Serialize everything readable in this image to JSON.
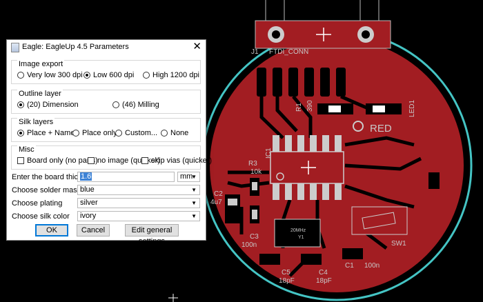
{
  "dialog": {
    "title": "Eagle: EagleUp 4.5 Parameters",
    "close_glyph": "✕",
    "image_export": {
      "legend": "Image export",
      "options": [
        "Very low 300 dpi",
        "Low 600 dpi",
        "High 1200 dpi"
      ],
      "selected": "Low 600 dpi"
    },
    "outline_layer": {
      "legend": "Outline layer",
      "options": [
        "(20) Dimension",
        "(46) Milling"
      ],
      "selected": "(20) Dimension"
    },
    "silk_layers": {
      "legend": "Silk layers",
      "options": [
        "Place + Names",
        "Place only",
        "Custom...",
        "None"
      ],
      "selected": "Place + Names"
    },
    "misc": {
      "legend": "Misc",
      "checks": [
        "Board only (no parts)",
        "no image (quicker)",
        "skip vias (quicker)"
      ]
    },
    "thickness": {
      "label": "Enter the board thickness",
      "value": "1.6",
      "unit": "mm"
    },
    "mask_color": {
      "label": "Choose solder mask color",
      "value": "blue"
    },
    "plating": {
      "label": "Choose plating",
      "value": "silver"
    },
    "silk_color": {
      "label": "Choose silk color",
      "value": "ivory"
    },
    "buttons": {
      "ok": "OK",
      "cancel": "Cancel",
      "general": "Edit general settings"
    }
  },
  "pcb": {
    "labels": {
      "j1": "J1",
      "ftdi": "FTDI_CONN",
      "r1": "R1",
      "r1_val": "390",
      "led1": "LED1",
      "red": "RED",
      "ic1": "IC1",
      "r3": "R3",
      "r3_val": "10k",
      "c2": "C2",
      "c2_val": "4u7",
      "c3": "C3",
      "c3_val": "100n",
      "crystal_freq": "20MHz",
      "y1": "Y1",
      "sw1": "SW1",
      "c5": "C5",
      "c5_val": "18pF",
      "c4": "C4",
      "c4_val": "18pF",
      "c1": "C1",
      "c1_val": "100n"
    },
    "colors": {
      "mask": "#a21d22",
      "outline": "#44c4c4",
      "background": "#000000",
      "silk": "#c8c8c8"
    }
  }
}
